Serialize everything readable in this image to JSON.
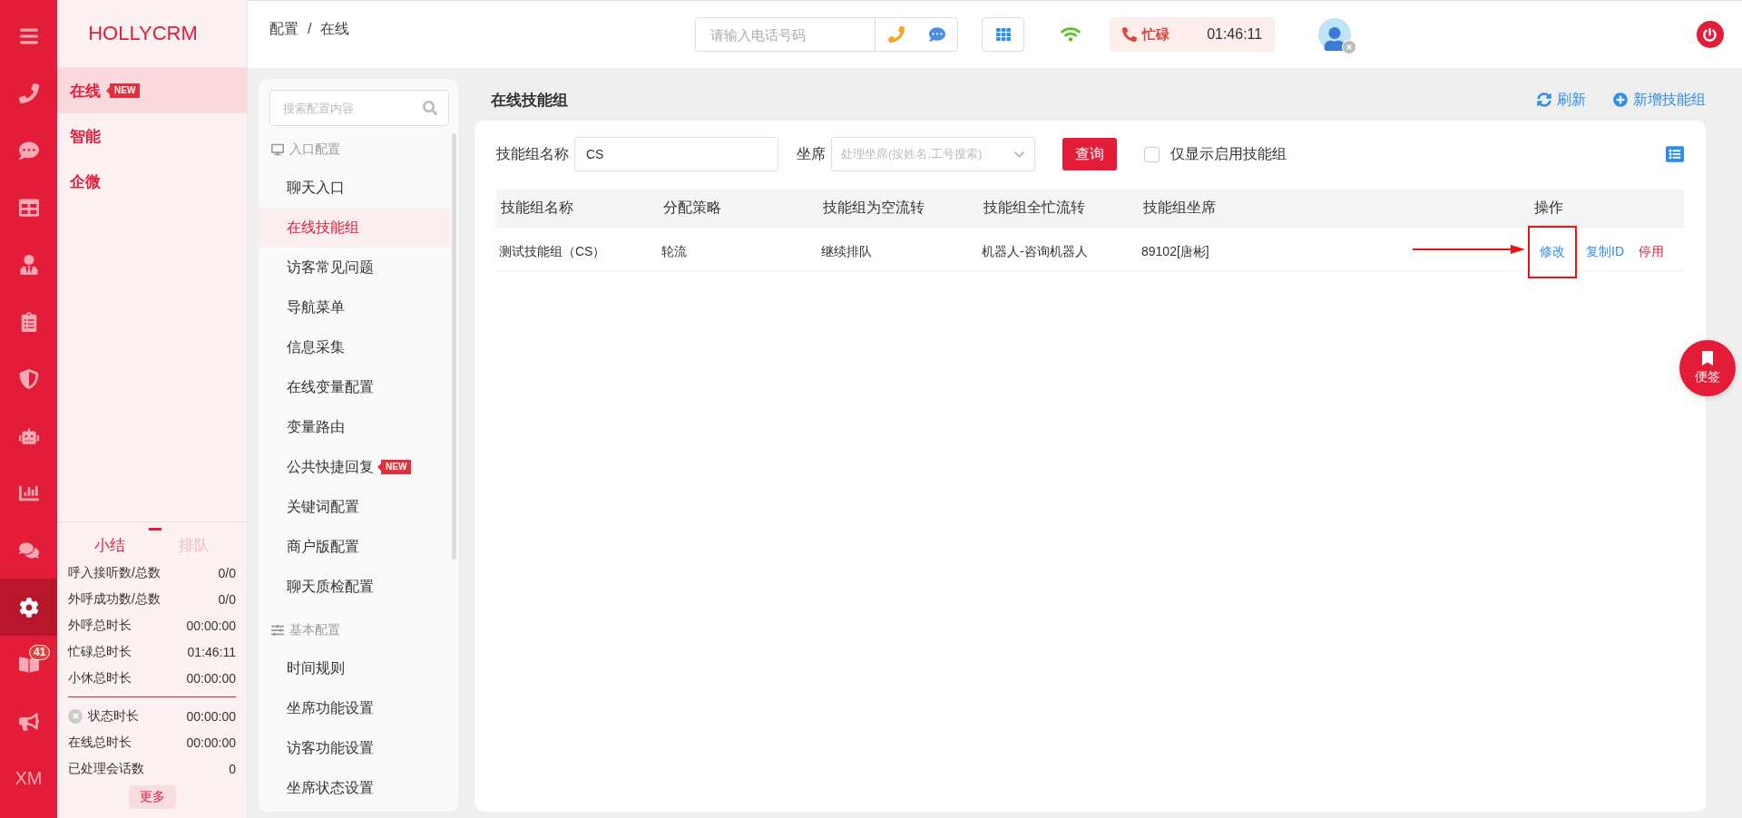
{
  "rail": {
    "items": [
      {
        "selected": false
      },
      {
        "selected": false
      },
      {
        "selected": false
      },
      {
        "selected": false
      },
      {
        "selected": false
      },
      {
        "selected": false
      },
      {
        "selected": false
      },
      {
        "selected": false
      },
      {
        "selected": false
      },
      {
        "selected": false
      },
      {
        "selected": true
      },
      {
        "selected": false,
        "badge": "41"
      },
      {
        "selected": false
      },
      {
        "selected": false,
        "label": "XM"
      }
    ]
  },
  "brand": {
    "logo": "HOLLYCRM"
  },
  "nav": [
    {
      "label": "在线",
      "badge": "NEW",
      "selected": true
    },
    {
      "label": "智能",
      "selected": false
    },
    {
      "label": "企微",
      "selected": false
    }
  ],
  "summary": {
    "tabs": [
      {
        "label": "小结",
        "selected": true
      },
      {
        "label": "排队",
        "selected": false
      }
    ],
    "stats": [
      {
        "label": "呼入接听数/总数",
        "value": "0/0"
      },
      {
        "label": "外呼成功数/总数",
        "value": "0/0"
      },
      {
        "label": "外呼总时长",
        "value": "00:00:00"
      },
      {
        "label": "忙碌总时长",
        "value": "01:46:11"
      },
      {
        "label": "小休总时长",
        "value": "00:00:00"
      }
    ],
    "status": [
      {
        "label": "状态时长",
        "value": "00:00:00",
        "kind": "status"
      },
      {
        "label": "在线总时长",
        "value": "00:00:00",
        "kind": "plain"
      },
      {
        "label": "已处理会话数",
        "value": "0",
        "kind": "plain"
      }
    ],
    "more_button": "更多"
  },
  "breadcrumb": {
    "items": [
      "配置",
      "在线"
    ],
    "separator": "/"
  },
  "topbar": {
    "phone_placeholder": "请输入电话号码",
    "status": {
      "label": "忙碌",
      "time": "01:46:11"
    }
  },
  "config_menu": {
    "search_placeholder": "搜索配置内容",
    "groups": [
      {
        "title": "入口配置",
        "kind": "entry",
        "items": [
          {
            "label": "聊天入口",
            "selected": false
          },
          {
            "label": "在线技能组",
            "selected": true
          },
          {
            "label": "访客常见问题",
            "selected": false
          },
          {
            "label": "导航菜单",
            "selected": false
          },
          {
            "label": "信息采集",
            "selected": false
          },
          {
            "label": "在线变量配置",
            "selected": false
          },
          {
            "label": "变量路由",
            "selected": false
          },
          {
            "label": "公共快捷回复",
            "selected": false,
            "badge": "NEW"
          },
          {
            "label": "关键词配置",
            "selected": false
          },
          {
            "label": "商户版配置",
            "selected": false
          },
          {
            "label": "聊天质检配置",
            "selected": false
          }
        ]
      },
      {
        "title": "基本配置",
        "kind": "basic",
        "items": [
          {
            "label": "时间规则",
            "selected": false
          },
          {
            "label": "坐席功能设置",
            "selected": false
          },
          {
            "label": "访客功能设置",
            "selected": false
          },
          {
            "label": "坐席状态设置",
            "selected": false
          }
        ]
      }
    ]
  },
  "page": {
    "title": "在线技能组",
    "actions": [
      {
        "label": "刷新",
        "kind": "refresh"
      },
      {
        "label": "新增技能组",
        "kind": "add"
      }
    ]
  },
  "filters": {
    "name_label": "技能组名称",
    "name_value": "CS",
    "agent_label": "坐席",
    "agent_placeholder": "处理坐席(按姓名,工号搜索)",
    "query_button": "查询",
    "enabled_only": {
      "label": "仅显示启用技能组",
      "checked": false
    }
  },
  "table": {
    "columns": [
      "技能组名称",
      "分配策略",
      "技能组为空流转",
      "技能组全忙流转",
      "技能组坐席",
      "操作"
    ],
    "rows": [
      {
        "cells": [
          "测试技能组（CS）",
          "轮流",
          "继续排队",
          "机器人-咨询机器人",
          "89102[唐彬]"
        ],
        "actions": [
          {
            "label": "修改",
            "kind": "link",
            "highlighted": true
          },
          {
            "label": "复制ID",
            "kind": "link",
            "highlighted": false
          },
          {
            "label": "停用",
            "kind": "danger",
            "highlighted": false
          }
        ]
      }
    ]
  },
  "memo_button": "便签"
}
